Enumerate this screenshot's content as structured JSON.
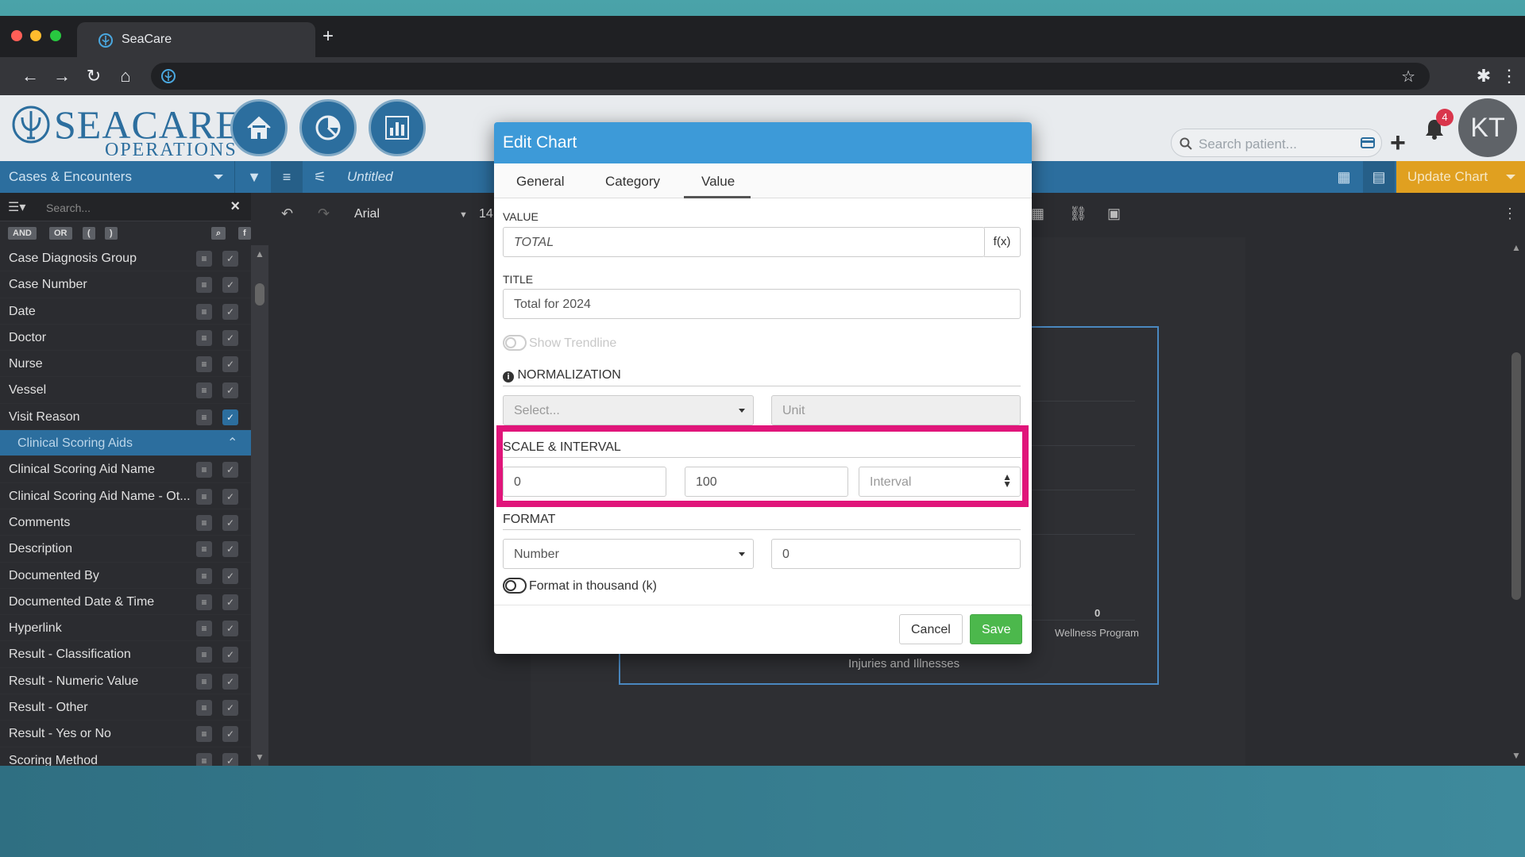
{
  "browser": {
    "tab_title": "SeaCare",
    "new_tab": "+"
  },
  "app": {
    "logo_text": "SEACARE",
    "logo_sub": "OPERATIONS",
    "search_placeholder": "Search patient...",
    "notification_count": "4",
    "avatar_initials": "KT"
  },
  "toolbar": {
    "dataset": "Cases & Encounters",
    "document_title": "Untitled",
    "update_chart": "Update Chart",
    "font_name": "Arial",
    "font_size": "14"
  },
  "sidebar": {
    "search_placeholder": "Search...",
    "logic": [
      "AND",
      "OR",
      "(",
      ")"
    ],
    "fields": [
      {
        "label": "Case Diagnosis Group",
        "checked": false
      },
      {
        "label": "Case Number",
        "checked": false
      },
      {
        "label": "Date",
        "checked": false
      },
      {
        "label": "Doctor",
        "checked": false
      },
      {
        "label": "Nurse",
        "checked": false
      },
      {
        "label": "Vessel",
        "checked": false
      },
      {
        "label": "Visit Reason",
        "checked": true
      }
    ],
    "group": "Clinical Scoring Aids",
    "group_fields": [
      {
        "label": "Clinical Scoring Aid Name"
      },
      {
        "label": "Clinical Scoring Aid Name - Ot..."
      },
      {
        "label": "Comments"
      },
      {
        "label": "Description"
      },
      {
        "label": "Documented By"
      },
      {
        "label": "Documented Date & Time"
      },
      {
        "label": "Hyperlink"
      },
      {
        "label": "Result - Classification"
      },
      {
        "label": "Result - Numeric Value"
      },
      {
        "label": "Result - Other"
      },
      {
        "label": "Result - Yes or No"
      },
      {
        "label": "Scoring Method"
      }
    ]
  },
  "chart_preview": {
    "zero_label": "0",
    "category_label": "Wellness Program",
    "axis_label": "Injuries and Illnesses"
  },
  "modal": {
    "title": "Edit Chart",
    "tabs": [
      "General",
      "Category",
      "Value"
    ],
    "active_tab": "Value",
    "value_label": "VALUE",
    "value": "TOTAL",
    "fx_label": "f(x)",
    "title_label": "TITLE",
    "title_value": "Total for 2024",
    "show_trendline": "Show Trendline",
    "normalization_label": "NORMALIZATION",
    "normalization_select": "Select...",
    "unit_placeholder": "Unit",
    "scale_label": "SCALE & INTERVAL",
    "scale_min": "0",
    "scale_max": "100",
    "interval_placeholder": "Interval",
    "format_label": "FORMAT",
    "format_select": "Number",
    "format_decimals": "0",
    "format_thousand": "Format in thousand (k)",
    "cancel": "Cancel",
    "save": "Save"
  },
  "colors": {
    "primary": "#2c6e9e",
    "modal_header": "#3d9ad8",
    "save": "#4cb84c",
    "update": "#e0a020",
    "highlight": "#e0157a"
  }
}
